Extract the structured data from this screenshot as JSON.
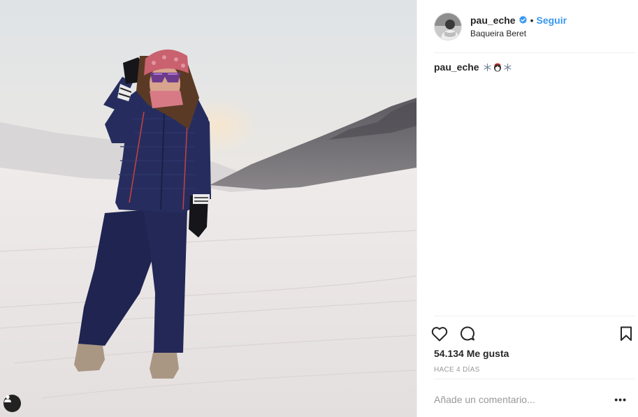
{
  "post": {
    "username": "pau_eche",
    "follow_label": "Seguir",
    "separator": "•",
    "location": "Baqueira Beret",
    "caption_user": "pau_eche",
    "caption_text": "❄ ❄",
    "likes": "54.134 Me gusta",
    "timestamp": "HACE 4 DÍAS",
    "comment_placeholder": "Añade un comentario...",
    "more_label": "•••"
  },
  "icons": {
    "verified": "verified-badge-icon",
    "like": "heart-icon",
    "comment": "comment-bubble-icon",
    "save": "bookmark-icon",
    "tagged": "user-tag-icon",
    "caption_emoji": [
      "snowflake-icon",
      "penguin-icon",
      "snowflake-icon"
    ]
  },
  "colors": {
    "link": "#3897f0",
    "text": "#262626",
    "muted": "#999999",
    "border": "#efefef"
  }
}
